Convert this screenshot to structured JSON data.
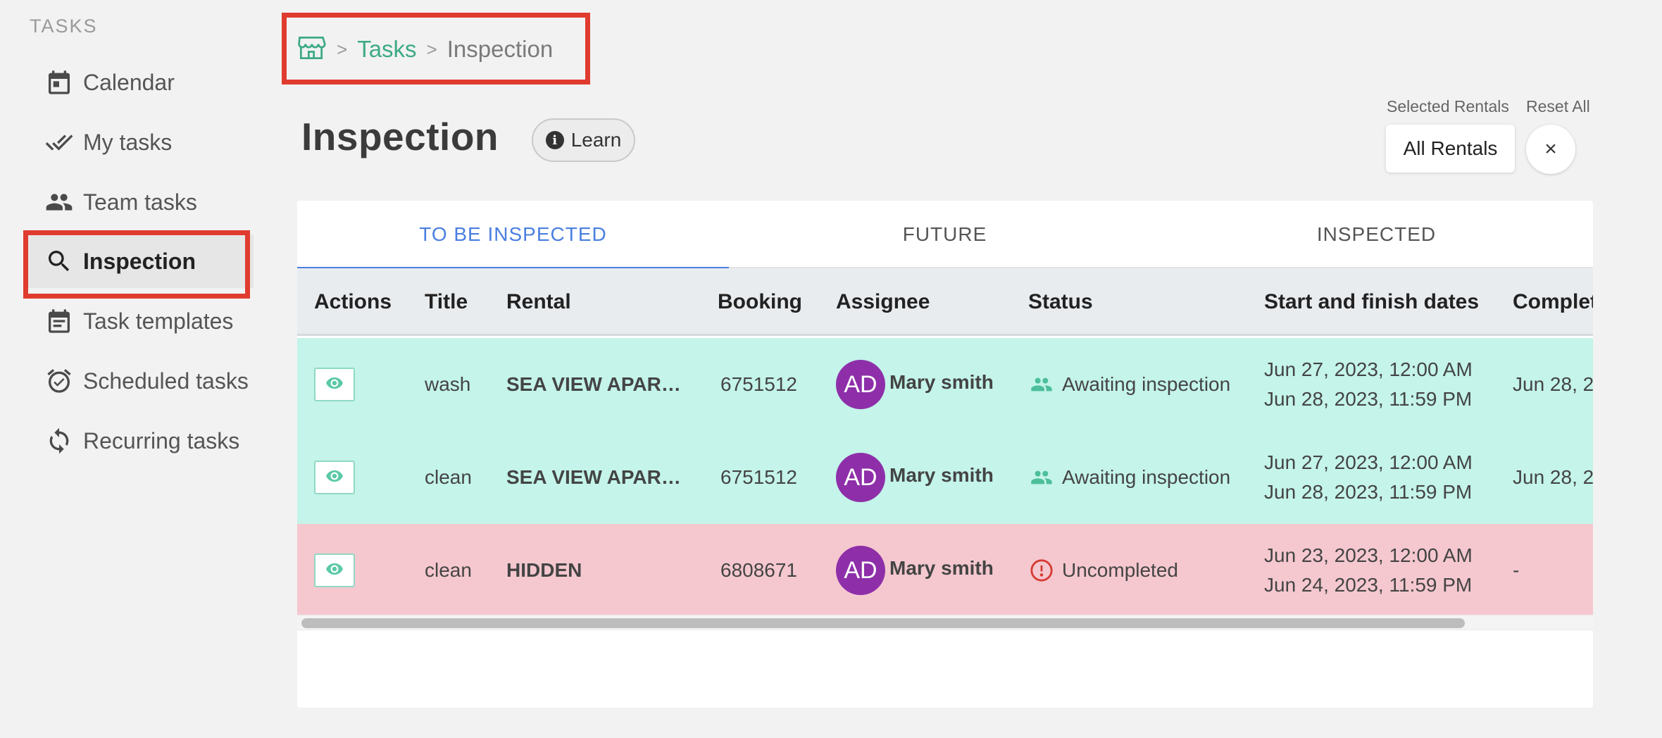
{
  "sidebar": {
    "heading": "TASKS",
    "items": [
      {
        "label": "Calendar",
        "icon": "calendar-icon"
      },
      {
        "label": "My tasks",
        "icon": "double-check-icon"
      },
      {
        "label": "Team tasks",
        "icon": "people-icon"
      },
      {
        "label": "Inspection",
        "icon": "search-icon",
        "active": true
      },
      {
        "label": "Task templates",
        "icon": "template-icon"
      },
      {
        "label": "Scheduled tasks",
        "icon": "alarm-icon"
      },
      {
        "label": "Recurring tasks",
        "icon": "recurring-icon"
      }
    ]
  },
  "breadcrumb": {
    "home_icon": "storefront-icon",
    "separator": ">",
    "link": "Tasks",
    "current": "Inspection"
  },
  "page": {
    "title": "Inspection",
    "learn_label": "Learn"
  },
  "filters": {
    "selected_rentals_label": "Selected Rentals",
    "reset_all_label": "Reset All",
    "rentals_value": "All Rentals",
    "reset_symbol": "×"
  },
  "tabs": [
    {
      "label": "TO BE INSPECTED",
      "active": true
    },
    {
      "label": "FUTURE"
    },
    {
      "label": "INSPECTED"
    }
  ],
  "table": {
    "columns": [
      "Actions",
      "Title",
      "Rental",
      "Booking",
      "Assignee",
      "Status",
      "Start and finish dates",
      "Complet"
    ],
    "rows": [
      {
        "title": "wash",
        "rental": "SEA VIEW APAR…",
        "booking": "6751512",
        "initials": "AD",
        "assignee": "Mary smith",
        "status": "Awaiting inspection",
        "start": "Jun 27, 2023, 12:00 AM",
        "finish": "Jun 28, 2023, 11:59 PM",
        "completed": "Jun 28, 2",
        "color": "#c4f4ea"
      },
      {
        "title": "clean",
        "rental": "SEA VIEW APAR…",
        "booking": "6751512",
        "initials": "AD",
        "assignee": "Mary smith",
        "status": "Awaiting inspection",
        "start": "Jun 27, 2023, 12:00 AM",
        "finish": "Jun 28, 2023, 11:59 PM",
        "completed": "Jun 28, 2",
        "color": "#c4f4ea"
      },
      {
        "title": "clean",
        "rental": "HIDDEN",
        "booking": "6808671",
        "initials": "AD",
        "assignee": "Mary smith",
        "status": "Uncompleted",
        "start": "Jun 23, 2023, 12:00 AM",
        "finish": "Jun 24, 2023, 11:59 PM",
        "completed": "-",
        "color": "#f5c8cf"
      }
    ]
  },
  "colors": {
    "accent_green": "#3daa85",
    "accent_blue": "#4a7fe0",
    "highlight_red": "#e03b2f",
    "avatar_purple": "#8e2fa9",
    "status_teal": "#4cbf9a",
    "status_red": "#d63b33"
  }
}
